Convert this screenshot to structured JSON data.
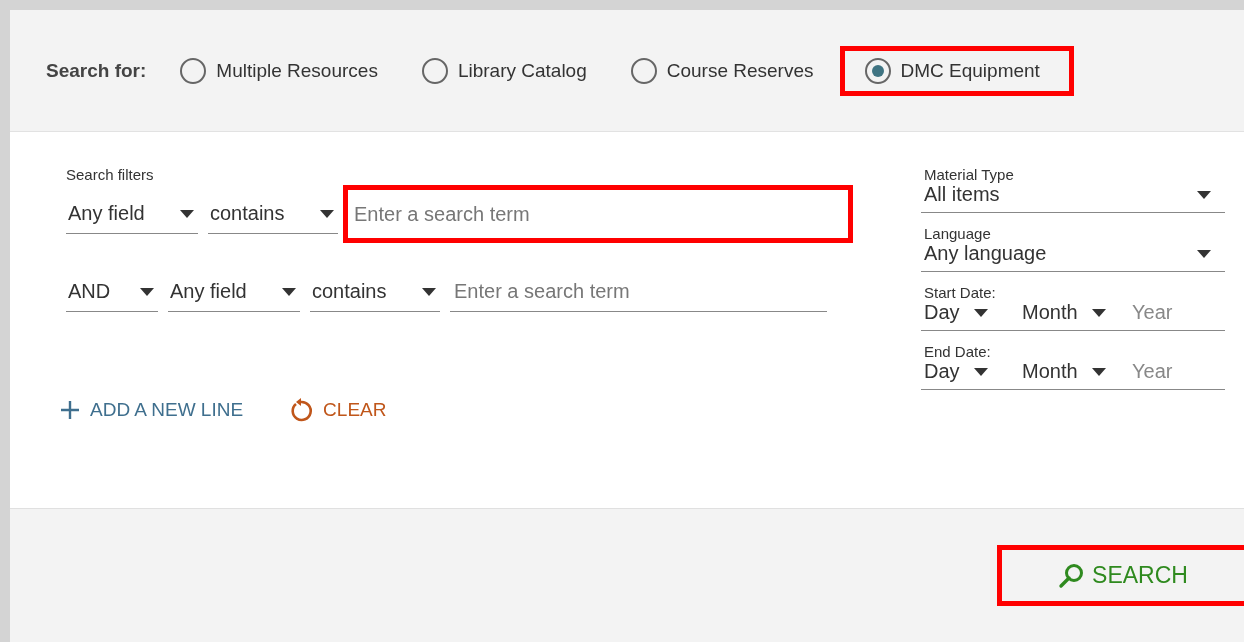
{
  "search_for": {
    "label": "Search for:",
    "options": [
      {
        "label": "Multiple Resources",
        "selected": false,
        "highlighted": false
      },
      {
        "label": "Library Catalog",
        "selected": false,
        "highlighted": false
      },
      {
        "label": "Course Reserves",
        "selected": false,
        "highlighted": false
      },
      {
        "label": "DMC Equipment",
        "selected": true,
        "highlighted": true
      }
    ]
  },
  "filters": {
    "label": "Search filters",
    "lines": [
      {
        "field": "Any field",
        "condition": "contains",
        "placeholder": "Enter a search term",
        "highlighted": true
      },
      {
        "operator": "AND",
        "field": "Any field",
        "condition": "contains",
        "placeholder": "Enter a search term",
        "highlighted": false
      }
    ],
    "add_line": "ADD A NEW LINE",
    "clear": "CLEAR"
  },
  "facets": [
    {
      "kind": "select",
      "label": "Material Type",
      "value": "All items"
    },
    {
      "kind": "select",
      "label": "Language",
      "value": "Any language"
    },
    {
      "kind": "date",
      "label": "Start Date:",
      "day": "Day",
      "month": "Month",
      "year": "Year"
    },
    {
      "kind": "date",
      "label": "End Date:",
      "day": "Day",
      "month": "Month",
      "year": "Year"
    }
  ],
  "search_button": {
    "label": "SEARCH",
    "highlighted": true
  }
}
